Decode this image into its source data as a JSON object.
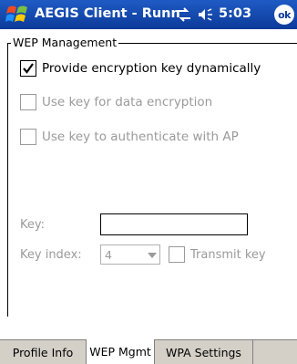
{
  "titlebar": {
    "app_title": "AEGIS Client - Runn",
    "time": "5:03",
    "ok_label": "ok"
  },
  "wep": {
    "group_title": "WEP Management",
    "provide_dynamic_label": "Provide encryption key dynamically",
    "provide_dynamic_checked": true,
    "use_data_label": "Use key for data encryption",
    "use_auth_label": "Use key to authenticate with AP",
    "key_label": "Key:",
    "key_value": "",
    "key_index_label": "Key index:",
    "key_index_value": "4",
    "transmit_key_label": "Transmit key"
  },
  "tabs": [
    {
      "label": "Profile Info"
    },
    {
      "label": "WEP Mgmt"
    },
    {
      "label": "WPA Settings"
    }
  ],
  "colors": {
    "titlebar_blue": "#0c3a9a",
    "disabled_text": "#9a9a9a",
    "tabbar_gray": "#d4d0c8"
  }
}
